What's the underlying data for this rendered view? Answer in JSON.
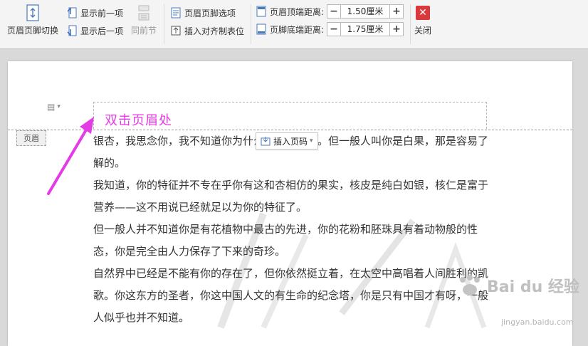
{
  "toolbar": {
    "switch_label": "页眉页脚切换",
    "show_prev_label": "显示前一项",
    "show_next_label": "显示后一项",
    "same_as_prev_label": "同前节",
    "options_label": "页眉页脚选项",
    "insert_align_tab_label": "插入对齐制表位",
    "header_top_label": "页眉顶端距离:",
    "header_top_value": "1.50厘米",
    "footer_bottom_label": "页脚底端距离:",
    "footer_bottom_value": "1.75厘米",
    "close_label": "关闭",
    "minus": "−",
    "plus": "+",
    "close_glyph": "✕"
  },
  "document": {
    "header_tag": "页眉",
    "annotation": "双击页眉处",
    "insert_page_number_label": "插入页码",
    "insert_page_number_arrow": "▾",
    "page_icon_glyph": "▤",
    "page_icon_arrow": "▾",
    "paragraphs": [
      "银杏，我思念你，我不知道你为什么又叫公孙树。但一般人叫你是白果，那是容易了解的。",
      "我知道，你的特征并不专在乎你有这和杏相仿的果实，核皮是纯白如银，核仁是富于营养——这不用说已经就足以为你的特征了。",
      "但一般人并不知道你是有花植物中最古的先进，你的花粉和胚珠具有着动物般的性态，你是完全由人力保存了下来的奇珍。",
      "自然界中已经是不能有你的存在了，但你依然挺立着，在太空中高唱着人间胜利的凯歌。你这东方的圣者，你这中国人文的有生命的纪念塔，你是只有中国才有呀，一般人似乎也并不知道。"
    ]
  },
  "watermark": {
    "brand": "Bai du 经验",
    "url": "jingyan.baidu.com"
  },
  "colors": {
    "annotation": "#e53be5",
    "close_button": "#d9383c",
    "page_background": "#ffffff",
    "workspace_background": "#d9d9d9"
  }
}
